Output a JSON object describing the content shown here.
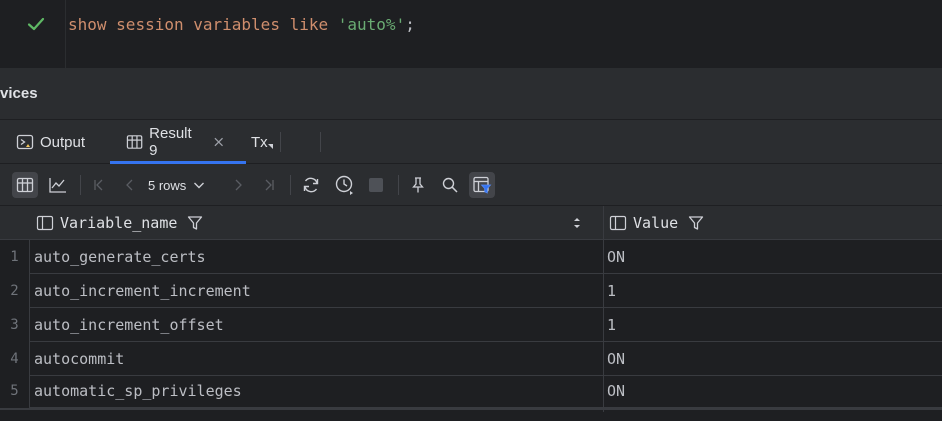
{
  "editor": {
    "keyword_show": "show",
    "keyword_session": "session",
    "word_variables": "variables",
    "keyword_like": "like",
    "string_pattern": "'auto%'",
    "terminator": ";"
  },
  "services": {
    "title": "vices"
  },
  "tabs": [
    {
      "label": "Output",
      "icon": "output-console-icon"
    },
    {
      "label": "Result 9",
      "icon": "table-grid-icon"
    },
    {
      "label": "Tx"
    }
  ],
  "toolbar": {
    "rows_label": "5 rows"
  },
  "grid": {
    "columns": [
      {
        "label": "Variable_name"
      },
      {
        "label": "Value"
      }
    ],
    "rows": [
      {
        "num": "1",
        "name": "auto_generate_certs",
        "value": "ON"
      },
      {
        "num": "2",
        "name": "auto_increment_increment",
        "value": "1"
      },
      {
        "num": "3",
        "name": "auto_increment_offset",
        "value": "1"
      },
      {
        "num": "4",
        "name": "autocommit",
        "value": "ON"
      },
      {
        "num": "5",
        "name": "automatic_sp_privileges",
        "value": "ON"
      }
    ]
  },
  "colors": {
    "accent": "#3574f0",
    "success": "#5fb865",
    "keyword": "#cf8e6d",
    "string": "#6aab73"
  }
}
